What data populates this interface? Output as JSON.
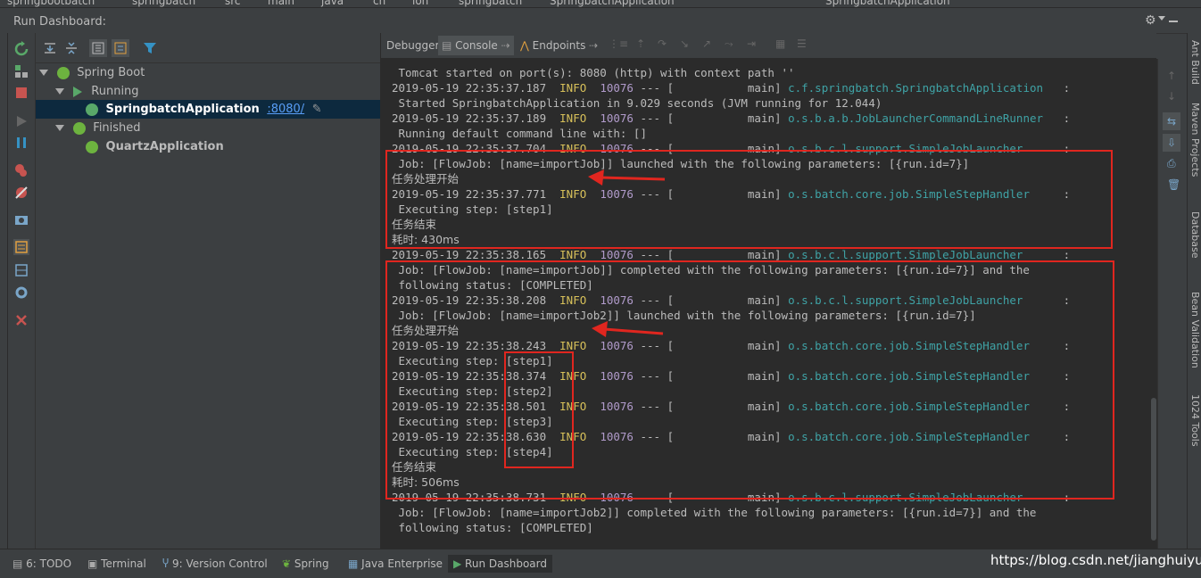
{
  "crumbs": [
    "springbootbatch",
    "springbatch",
    "src",
    "main",
    "java",
    "cn",
    "lon",
    "springbatch",
    "SpringbatchApplication",
    "SpringbatchApplication"
  ],
  "window": {
    "title": "Run Dashboard:"
  },
  "tree": {
    "root": "Spring Boot",
    "running_group": "Running",
    "running_app": "SpringbatchApplication",
    "running_port": ":8080/",
    "finished_group": "Finished",
    "finished_app": "QuartzApplication"
  },
  "console_tabs": {
    "debugger": "Debugger",
    "console": "Console",
    "endpoints": "Endpoints"
  },
  "log": [
    {
      "text": " Tomcat started on port(s): 8080 (http) with context path ''"
    },
    {
      "ts": "2019-05-19 22:35:37.187",
      "level": "INFO",
      "pid": "10076",
      "sep": " --- [           main] ",
      "logger": "c.f.springbatch.SpringbatchApplication  ",
      "tail": " :"
    },
    {
      "text": " Started SpringbatchApplication in 9.029 seconds (JVM running for 12.044)"
    },
    {
      "ts": "2019-05-19 22:35:37.189",
      "level": "INFO",
      "pid": "10076",
      "sep": " --- [           main] ",
      "logger": "o.s.b.a.b.JobLauncherCommandLineRunner  ",
      "tail": " :"
    },
    {
      "text": " Running default command line with: []"
    },
    {
      "ts": "2019-05-19 22:35:37.704",
      "level": "INFO",
      "pid": "10076",
      "sep": " --- [           main] ",
      "logger": "o.s.b.c.l.support.SimpleJobLauncher     ",
      "tail": " :"
    },
    {
      "text": " Job: [FlowJob: [name=importJob]] launched with the following parameters: [{run.id=7}]"
    },
    {
      "text": "任务处理开始",
      "cjk": true
    },
    {
      "ts": "2019-05-19 22:35:37.771",
      "level": "INFO",
      "pid": "10076",
      "sep": " --- [           main] ",
      "logger": "o.s.batch.core.job.SimpleStepHandler    ",
      "tail": " :"
    },
    {
      "text": " Executing step: [step1]"
    },
    {
      "text": "任务结束",
      "cjk": true
    },
    {
      "text": "耗时: 430ms",
      "cjk": true
    },
    {
      "ts": "2019-05-19 22:35:38.165",
      "level": "INFO",
      "pid": "10076",
      "sep": " --- [           main] ",
      "logger": "o.s.b.c.l.support.SimpleJobLauncher     ",
      "tail": " :"
    },
    {
      "text": " Job: [FlowJob: [name=importJob]] completed with the following parameters: [{run.id=7}] and the"
    },
    {
      "text": " following status: [COMPLETED]"
    },
    {
      "ts": "2019-05-19 22:35:38.208",
      "level": "INFO",
      "pid": "10076",
      "sep": " --- [           main] ",
      "logger": "o.s.b.c.l.support.SimpleJobLauncher     ",
      "tail": " :"
    },
    {
      "text": " Job: [FlowJob: [name=importJob2]] launched with the following parameters: [{run.id=7}]"
    },
    {
      "text": "任务处理开始",
      "cjk": true
    },
    {
      "ts": "2019-05-19 22:35:38.243",
      "level": "INFO",
      "pid": "10076",
      "sep": " --- [           main] ",
      "logger": "o.s.batch.core.job.SimpleStepHandler    ",
      "tail": " :"
    },
    {
      "text": " Executing step: [step1]"
    },
    {
      "ts": "2019-05-19 22:35:38.374",
      "level": "INFO",
      "pid": "10076",
      "sep": " --- [           main] ",
      "logger": "o.s.batch.core.job.SimpleStepHandler    ",
      "tail": " :"
    },
    {
      "text": " Executing step: [step2]"
    },
    {
      "ts": "2019-05-19 22:35:38.501",
      "level": "INFO",
      "pid": "10076",
      "sep": " --- [           main] ",
      "logger": "o.s.batch.core.job.SimpleStepHandler    ",
      "tail": " :"
    },
    {
      "text": " Executing step: [step3]"
    },
    {
      "ts": "2019-05-19 22:35:38.630",
      "level": "INFO",
      "pid": "10076",
      "sep": " --- [           main] ",
      "logger": "o.s.batch.core.job.SimpleStepHandler    ",
      "tail": " :"
    },
    {
      "text": " Executing step: [step4]"
    },
    {
      "text": "任务结束",
      "cjk": true
    },
    {
      "text": "耗时: 506ms",
      "cjk": true
    },
    {
      "ts": "2019-05-19 22:35:38.731",
      "level": "INFO",
      "pid": "10076",
      "sep": " --- [           main] ",
      "logger": "o.s.b.c.l.support.SimpleJobLauncher     ",
      "tail": " :"
    },
    {
      "text": " Job: [FlowJob: [name=importJob2]] completed with the following parameters: [{run.id=7}] and the"
    },
    {
      "text": " following status: [COMPLETED]"
    }
  ],
  "right_sidebar": [
    "Ant Build",
    "Maven Projects",
    "Database",
    "Bean Validation",
    "1024 Tools"
  ],
  "bottom_tabs": [
    "6: TODO",
    "Terminal",
    "9: Version Control",
    "Spring",
    "Java Enterprise",
    "Run Dashboard"
  ],
  "watermark": "https://blog.csdn.net/jianghuiyun",
  "colors": {
    "annotation": "#e0261f",
    "info": "#d7c05a",
    "logger": "#3fa3a6",
    "selection": "#0d293e"
  }
}
